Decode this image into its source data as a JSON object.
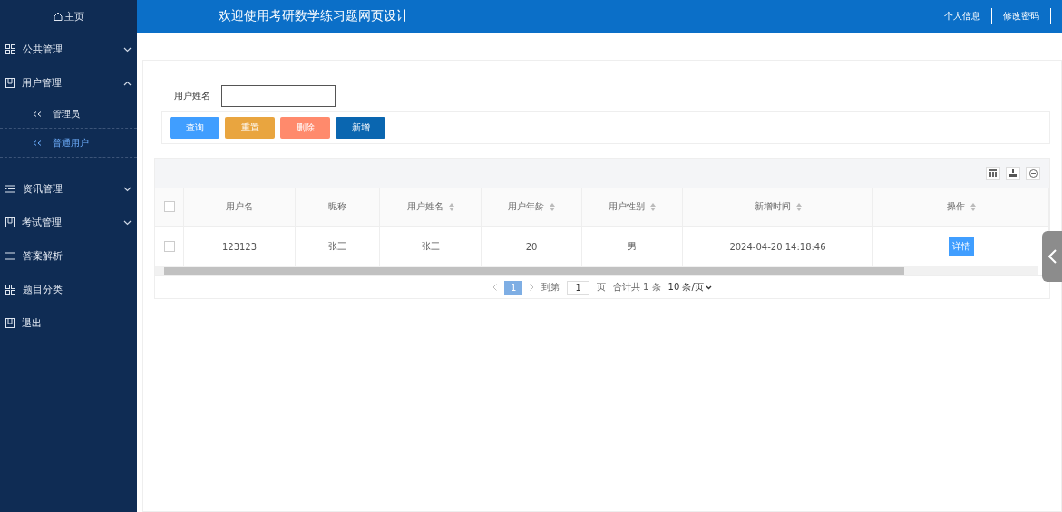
{
  "sidebar": {
    "home": "主页",
    "items": [
      {
        "label": "公共管理",
        "expanded": false
      },
      {
        "label": "用户管理",
        "expanded": true,
        "children": [
          {
            "label": "管理员",
            "selected": false
          },
          {
            "label": "普通用户",
            "selected": true
          }
        ]
      },
      {
        "label": "资讯管理",
        "expanded": false
      },
      {
        "label": "考试管理",
        "expanded": false
      },
      {
        "label": "答案解析"
      },
      {
        "label": "题目分类"
      },
      {
        "label": "退出"
      }
    ]
  },
  "header": {
    "title": "欢迎使用考研数学练习题网页设计",
    "links": [
      "个人信息",
      "修改密码"
    ]
  },
  "search": {
    "label": "用户姓名"
  },
  "buttons": [
    {
      "label": "查询",
      "color": "#409eff"
    },
    {
      "label": "重置",
      "color": "#e9a53f"
    },
    {
      "label": "删除",
      "color": "#ff8a6c"
    },
    {
      "label": "新增",
      "color": "#0a66b0"
    }
  ],
  "table": {
    "all_checked": false,
    "columns": [
      {
        "label": "用户名",
        "sortable": false
      },
      {
        "label": "昵称",
        "sortable": false
      },
      {
        "label": "用户姓名",
        "sortable": true
      },
      {
        "label": "用户年龄",
        "sortable": true
      },
      {
        "label": "用户性别",
        "sortable": true
      },
      {
        "label": "新增时间",
        "sortable": true
      },
      {
        "label": "操作",
        "sortable": true
      }
    ],
    "rows": [
      {
        "checked": false,
        "cells": [
          "123123",
          "张三",
          "张三",
          "20",
          "男",
          "2024-04-20 14:18:46"
        ],
        "action": "详情"
      }
    ]
  },
  "pagination": {
    "current": "1",
    "goto_label": "到第",
    "goto_value": "1",
    "page_unit": "页",
    "total": "合计共 1 条",
    "page_size": "10 条/页"
  }
}
